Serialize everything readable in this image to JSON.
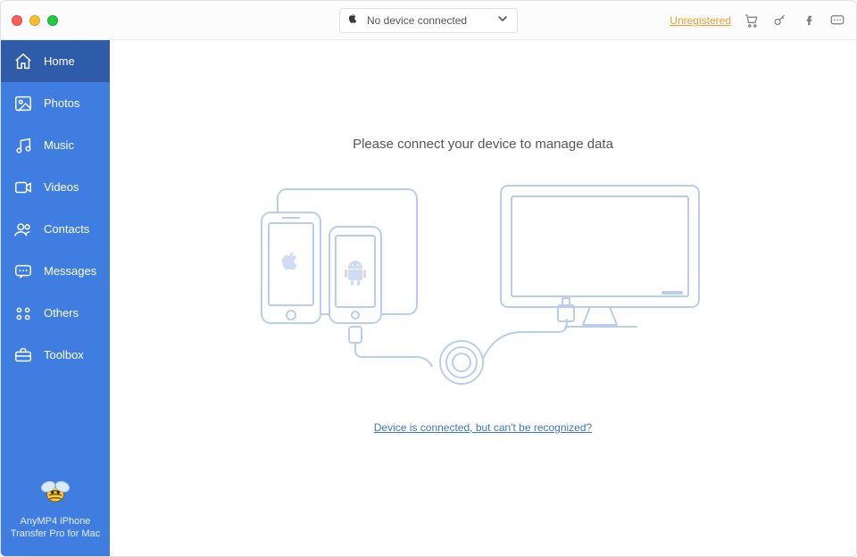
{
  "titlebar": {
    "device_label": "No device connected",
    "unregistered": "Unregistered"
  },
  "sidebar": {
    "items": [
      {
        "label": "Home"
      },
      {
        "label": "Photos"
      },
      {
        "label": "Music"
      },
      {
        "label": "Videos"
      },
      {
        "label": "Contacts"
      },
      {
        "label": "Messages"
      },
      {
        "label": "Others"
      },
      {
        "label": "Toolbox"
      }
    ],
    "brand": "AnyMP4 iPhone Transfer Pro for Mac"
  },
  "main": {
    "headline": "Please connect your device to manage data",
    "help_link": "Device is connected, but can't be recognized?"
  },
  "colors": {
    "sidebar": "#3f7de0",
    "sidebar_active": "#2f5ca8",
    "accent_link": "#3e74c9",
    "unregistered": "#f29a2e",
    "illustration": "#b9ceef"
  }
}
